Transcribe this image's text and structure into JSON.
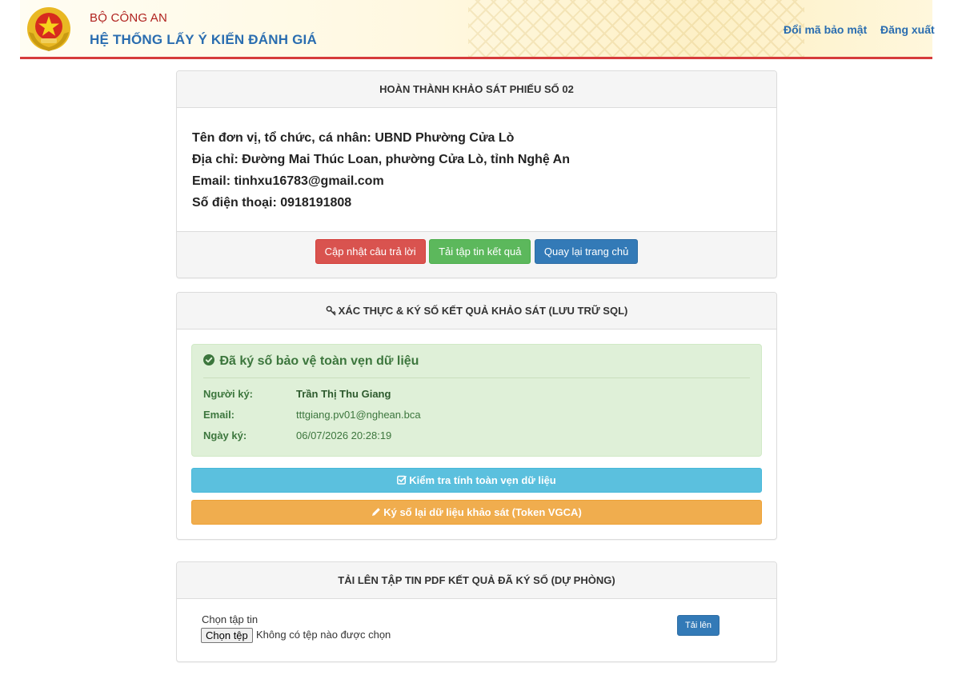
{
  "header": {
    "org": "BỘ CÔNG AN",
    "system_title": "HỆ THỐNG LẤY Ý KIẾN ĐÁNH GIÁ",
    "links": [
      "Đổi mã bảo mật",
      "Đăng xuất"
    ]
  },
  "panel1": {
    "title": "HOÀN THÀNH KHẢO SÁT PHIẾU SỐ 02",
    "info": [
      "Tên đơn vị, tổ chức, cá nhân: UBND Phường Cửa Lò",
      "Địa chỉ: Đường Mai Thúc Loan, phường Cửa Lò, tỉnh Nghệ An",
      "Email: tinhxu16783@gmail.com",
      "Số điện thoại: 0918191808"
    ],
    "buttons": [
      "Cập nhật câu trả lời",
      "Tải tập tin kết quả",
      "Quay lại trang chủ"
    ]
  },
  "panel2": {
    "title": "XÁC THỰC & KÝ SỐ KẾT QUẢ KHẢO SÁT (LƯU TRỮ SQL)",
    "alert": {
      "title": "Đã ký số bảo vệ toàn vẹn dữ liệu",
      "rows": [
        {
          "label": "Người ký:",
          "value": "Trần Thị Thu Giang"
        },
        {
          "label": "Email:",
          "value": "tttgiang.pv01@nghean.bca"
        },
        {
          "label": "Ngày ký:",
          "value": "06/07/2026 20:28:19"
        }
      ]
    },
    "verify_button": "Kiểm tra tính toàn vẹn dữ liệu",
    "resign_button": "Ký số lại dữ liệu khảo sát (Token VGCA)"
  },
  "panel3": {
    "title": "TẢI LÊN TẬP TIN PDF KẾT QUẢ ĐÃ KÝ SỐ (DỰ PHÒNG)",
    "file_label": "Chọn tập tin",
    "file_button": "Chọn tệp",
    "file_status": "Không có tệp nào được chọn",
    "upload_button": "Tải lên"
  },
  "colors": {
    "brand_red": "#d63b3b",
    "brand_blue": "#2a6db0",
    "success_bg": "#dff0d8"
  }
}
